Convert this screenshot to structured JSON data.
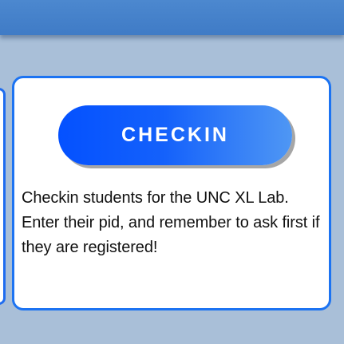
{
  "header": {
    "visible_text": ""
  },
  "card": {
    "button_label": "CHECKIN",
    "description": "Checkin students for the UNC XL Lab. Enter their pid, and remember to ask first if they are registered!"
  },
  "colors": {
    "header": "#4c88cf",
    "background": "#a9bfd8",
    "card_border": "#1c73f2",
    "button_gradient_start": "#0451ff",
    "button_gradient_end": "#4f97f4",
    "button_shadow": "#a6a6a6",
    "text": "#111111"
  }
}
